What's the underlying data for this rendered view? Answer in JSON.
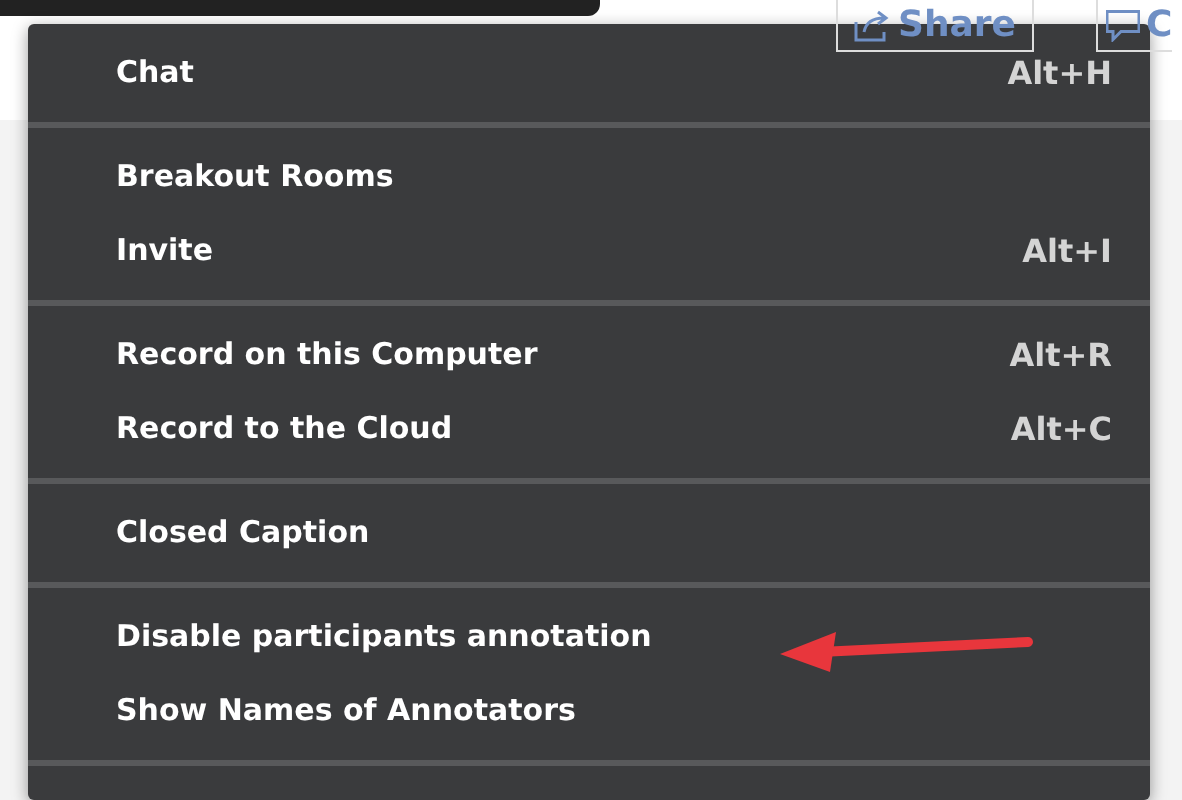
{
  "background": {
    "share_button": "Share",
    "comment_button": "C"
  },
  "menu": {
    "groups": [
      {
        "items": [
          {
            "label": "Chat",
            "shortcut": "Alt+H"
          }
        ]
      },
      {
        "items": [
          {
            "label": "Breakout Rooms"
          },
          {
            "label": "Invite",
            "shortcut": "Alt+I"
          }
        ]
      },
      {
        "items": [
          {
            "label": "Record on this Computer",
            "shortcut": "Alt+R"
          },
          {
            "label": "Record to the Cloud",
            "shortcut": "Alt+C"
          }
        ]
      },
      {
        "items": [
          {
            "label": "Closed Caption"
          }
        ]
      },
      {
        "items": [
          {
            "label": "Disable participants annotation"
          },
          {
            "label": "Show Names of Annotators"
          }
        ]
      }
    ]
  }
}
